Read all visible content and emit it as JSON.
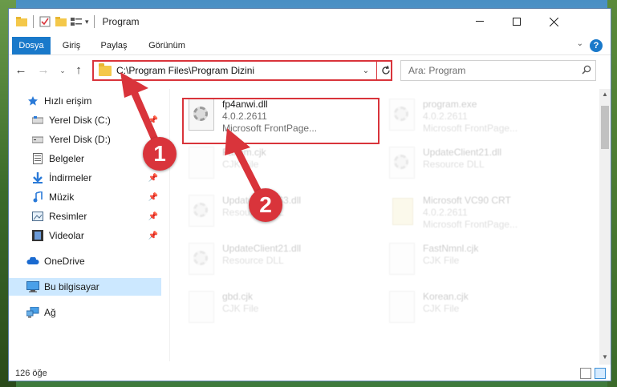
{
  "window": {
    "title": "Program"
  },
  "ribbon": {
    "tabs": [
      {
        "label": "Dosya",
        "active": true
      },
      {
        "label": "Giriş"
      },
      {
        "label": "Paylaş"
      },
      {
        "label": "Görünüm"
      }
    ],
    "help": "?"
  },
  "address": {
    "path": "C:\\Program Files\\Program Dizini"
  },
  "search": {
    "placeholder": "Ara: Program"
  },
  "sidebar": {
    "items": [
      {
        "label": "Hızlı erişim",
        "icon": "star-icon"
      },
      {
        "label": "Yerel Disk (C:)",
        "icon": "drive-icon",
        "pinned": true
      },
      {
        "label": "Yerel Disk (D:)",
        "icon": "drive-icon"
      },
      {
        "label": "Belgeler",
        "icon": "documents-icon",
        "pinned": true
      },
      {
        "label": "İndirmeler",
        "icon": "download-icon",
        "pinned": true
      },
      {
        "label": "Müzik",
        "icon": "music-icon",
        "pinned": true
      },
      {
        "label": "Resimler",
        "icon": "pictures-icon",
        "pinned": true
      },
      {
        "label": "Videolar",
        "icon": "videos-icon",
        "pinned": true
      },
      {
        "label": "OneDrive",
        "icon": "cloud-icon"
      },
      {
        "label": "Bu bilgisayar",
        "icon": "computer-icon",
        "selected": true
      },
      {
        "label": "Ağ",
        "icon": "network-icon"
      }
    ]
  },
  "files": [
    {
      "name": "fp4anwi.dll",
      "line1": "4.0.2.2611",
      "line2": "Microsoft FrontPage...",
      "highlighted": true
    },
    {
      "name": "program.exe",
      "line1": "4.0.2.2611",
      "line2": "Microsoft FrontPage..."
    },
    {
      "name": "Farsim.cjk",
      "line1": "CJK File",
      "line2": ""
    },
    {
      "name": "UpdateClient21.dll",
      "line1": "Resource DLL",
      "line2": ""
    },
    {
      "name": "UpdateClient63.dll",
      "line1": "Resource DLL",
      "line2": ""
    },
    {
      "name": "Microsoft VC90 CRT",
      "line1": "4.0.2.2611",
      "line2": "Microsoft FrontPage..."
    },
    {
      "name": "UpdateClient21.dll",
      "line1": "Resource DLL",
      "line2": ""
    },
    {
      "name": "FastNmnl.cjk",
      "line1": "CJK File",
      "line2": ""
    },
    {
      "name": "gbd.cjk",
      "line1": "CJK File",
      "line2": ""
    },
    {
      "name": "Korean.cjk",
      "line1": "CJK File",
      "line2": ""
    }
  ],
  "status": {
    "count": "126 öğe"
  },
  "annotations": {
    "step1": "1",
    "step2": "2",
    "color": "#d9343b"
  }
}
